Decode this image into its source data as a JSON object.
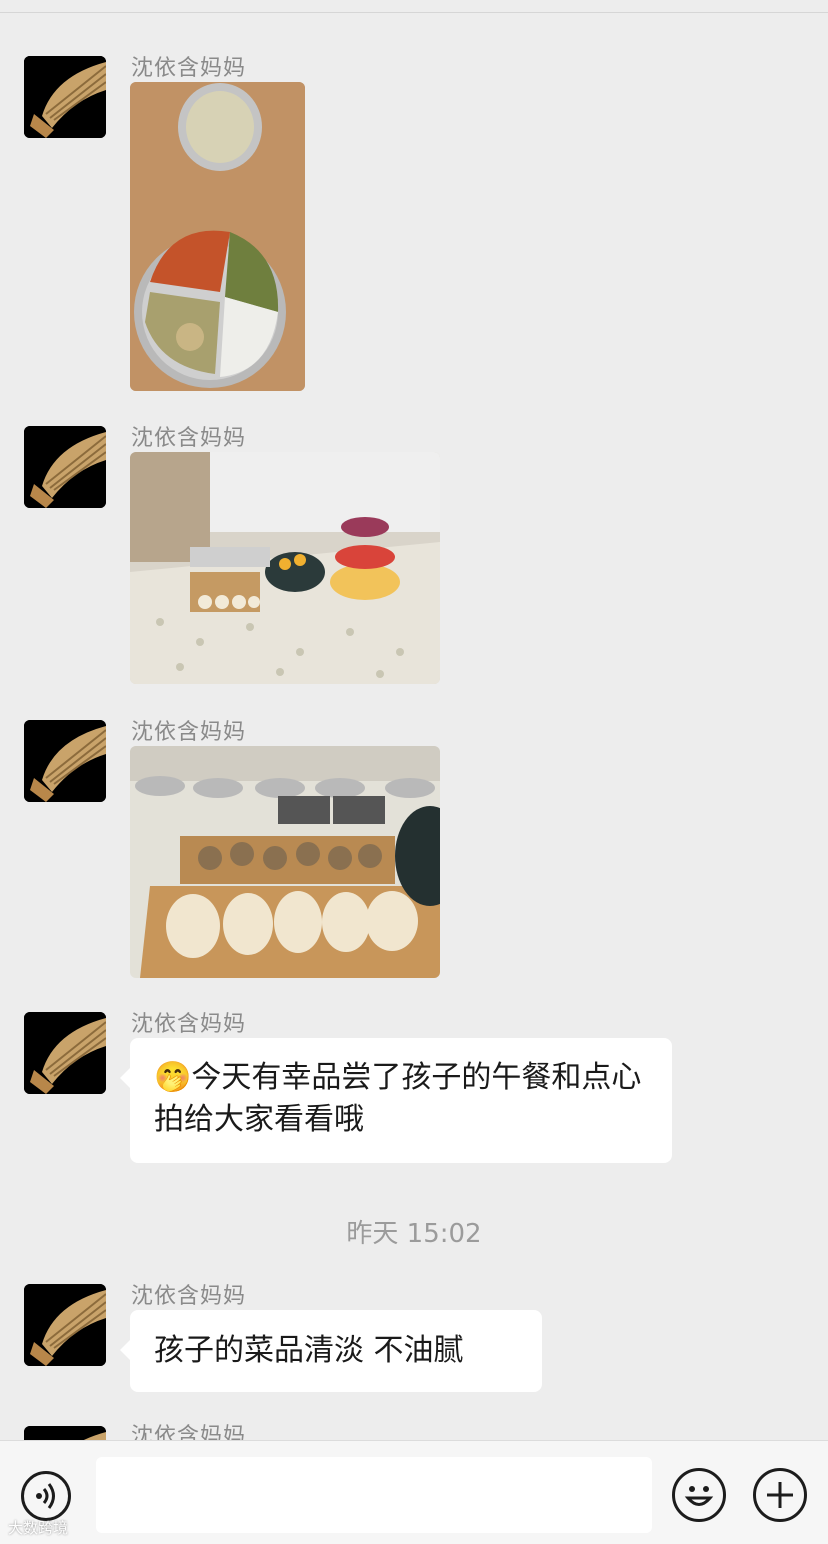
{
  "messages": [
    {
      "sender": "沈依含妈妈",
      "type": "image",
      "image_desc": "lunch-tray-photo"
    },
    {
      "sender": "沈依含妈妈",
      "type": "image",
      "image_desc": "snack-table-photo"
    },
    {
      "sender": "沈依含妈妈",
      "type": "image",
      "image_desc": "buns-dumplings-photo"
    },
    {
      "sender": "沈依含妈妈",
      "type": "text",
      "emoji": "🤭",
      "text": "今天有幸品尝了孩子的午餐和点心 拍给大家看看哦"
    },
    {
      "sender": "沈依含妈妈",
      "type": "text",
      "text": "孩子的菜品清淡 不油腻"
    },
    {
      "sender": "沈依含妈妈",
      "type": "partial"
    }
  ],
  "timestamp": "昨天 15:02",
  "input_bar": {
    "placeholder": "",
    "value": ""
  },
  "watermark": "大数跨境",
  "icons": {
    "voice": "voice-icon",
    "emoji": "emoji-icon",
    "plus": "plus-icon",
    "avatar": "fan-avatar-icon"
  },
  "colors": {
    "background": "#ededed",
    "bubble": "#ffffff",
    "sender": "#8a8a8a"
  }
}
